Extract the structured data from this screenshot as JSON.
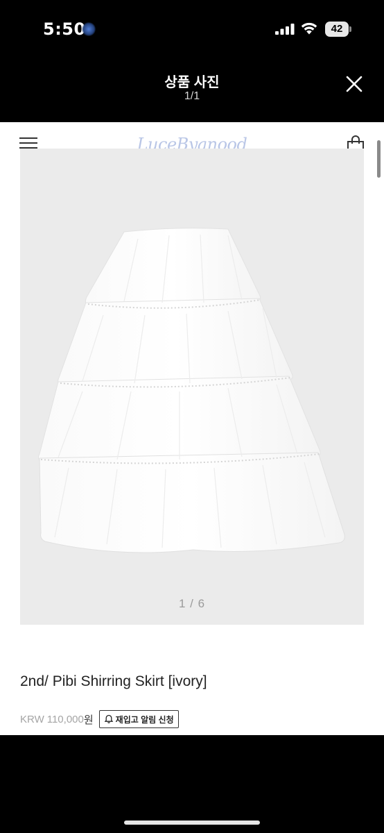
{
  "status_bar": {
    "time": "5:50",
    "battery": "42",
    "icons": [
      "focus-dot",
      "cellular-signal-icon",
      "wifi-icon",
      "battery-icon"
    ]
  },
  "viewer": {
    "title": "상품 사진",
    "counter": "1/1",
    "close_icon": "close-icon"
  },
  "shop": {
    "menu_icon": "hamburger-menu-icon",
    "brand": "LuceByanood",
    "cart_icon": "shopping-bag-icon"
  },
  "product": {
    "image_counter": "1 / 6",
    "name": "2nd/ Pibi Shirring Skirt [ivory]",
    "price_currency": "KRW",
    "price_value": "110,000",
    "price_unit": "원",
    "restock_label": "재입고 알림 신청",
    "restock_icon": "bell-icon"
  },
  "colors": {
    "background": "#000000",
    "page": "#ffffff",
    "image_bg": "#ebebeb",
    "brand": "#b9c6e6"
  }
}
